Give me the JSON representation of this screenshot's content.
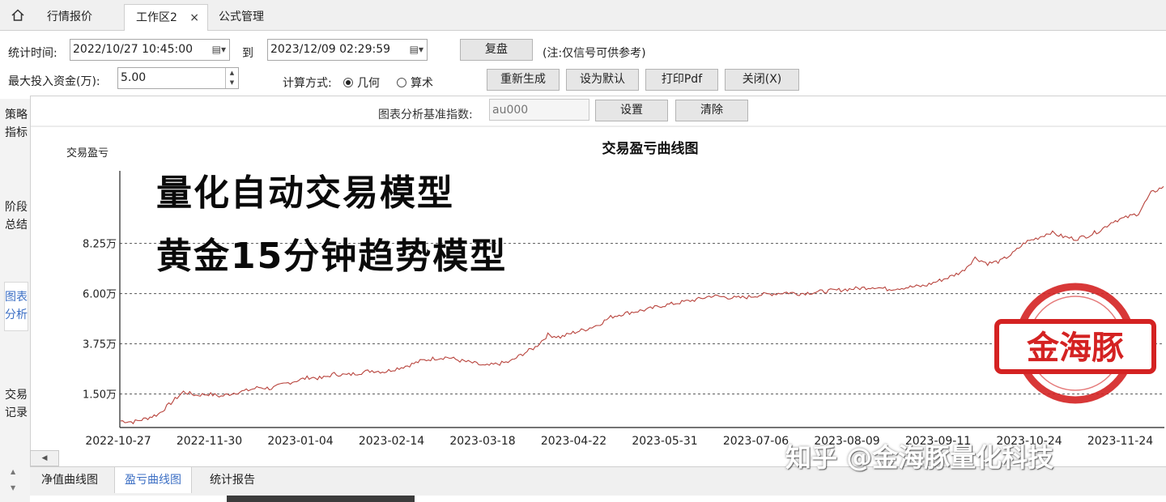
{
  "tabs": {
    "home_icon": "home-icon",
    "items": [
      "行情报价",
      "工作区2",
      "公式管理"
    ],
    "close_glyph": "×"
  },
  "toolbar": {
    "stat_time_label": "统计时间:",
    "start_time": "2022/10/27 10:45:00",
    "to_label": "到",
    "end_time": "2023/12/09 02:29:59",
    "replay_button": "复盘",
    "note": "(注:仅信号可供参考)",
    "max_capital_label": "最大投入资金(万):",
    "max_capital_value": "5.00",
    "calc_method_label": "计算方式:",
    "method_geometric": "几何",
    "method_arithmetic": "算术",
    "method_selected": "geometric",
    "regenerate_button": "重新生成",
    "set_default_button": "设为默认",
    "print_pdf_button": "打印Pdf",
    "close_button": "关闭(X)",
    "benchmark_label": "图表分析基准指数:",
    "benchmark_placeholder": "au000",
    "settings_button": "设置",
    "clear_button": "清除"
  },
  "sidebar": {
    "items": [
      "策略指标",
      "阶段总结",
      "图表分析",
      "交易记录"
    ],
    "active": "图表分析"
  },
  "overlay": {
    "line1": "量化自动交易模型",
    "line2": "黄金15分钟趋势模型",
    "stamp_text": "金海豚",
    "watermark": "知乎 @金海豚量化科技"
  },
  "bottom_tabs": {
    "items": [
      "净值曲线图",
      "盈亏曲线图",
      "统计报告"
    ],
    "active": "盈亏曲线图"
  },
  "colors": {
    "line": "#b8433c",
    "stamp": "#d42222",
    "active_tab": "#3c6fc4"
  },
  "chart_data": {
    "type": "line",
    "title": "交易盈亏曲线图",
    "ylabel": "交易盈亏",
    "ylim": [
      0.0,
      11.5
    ],
    "yticks": [
      {
        "value": 1.5,
        "label": "1.50万"
      },
      {
        "value": 3.75,
        "label": "3.75万"
      },
      {
        "value": 6.0,
        "label": "6.00万"
      },
      {
        "value": 8.25,
        "label": "8.25万"
      }
    ],
    "xtick_labels": [
      "2022-10-27",
      "2022-11-30",
      "2023-01-04",
      "2023-02-14",
      "2023-03-18",
      "2023-04-22",
      "2023-05-31",
      "2023-07-06",
      "2023-08-09",
      "2023-09-11",
      "2023-10-24",
      "2023-11-24"
    ],
    "grid": "horizontal-dashed",
    "series": [
      {
        "values": [
          0.3,
          0.25,
          0.4,
          0.6,
          1.1,
          1.6,
          1.45,
          1.5,
          1.4,
          1.55,
          1.65,
          1.8,
          1.75,
          1.95,
          2.1,
          2.25,
          2.2,
          2.4,
          2.35,
          2.45,
          2.55,
          2.5,
          2.65,
          2.8,
          3.0,
          3.1,
          3.15,
          3.0,
          2.9,
          2.75,
          2.85,
          2.95,
          3.3,
          3.6,
          4.15,
          4.05,
          4.25,
          4.4,
          4.6,
          4.95,
          5.1,
          5.2,
          5.3,
          5.45,
          5.55,
          5.65,
          5.75,
          5.9,
          5.85,
          5.8,
          5.85,
          5.95,
          6.0,
          6.05,
          6.0,
          6.05,
          6.1,
          6.15,
          6.2,
          6.25,
          6.3,
          6.2,
          6.25,
          6.3,
          6.35,
          6.55,
          6.75,
          7.0,
          7.6,
          7.35,
          7.45,
          7.8,
          8.3,
          8.5,
          8.75,
          8.55,
          8.45,
          8.6,
          8.85,
          9.25,
          9.4,
          9.6,
          10.5,
          10.8
        ]
      }
    ]
  }
}
